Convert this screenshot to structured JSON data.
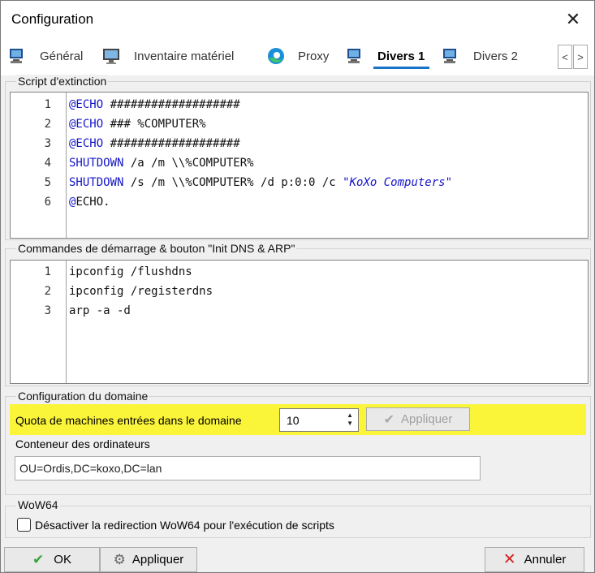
{
  "window": {
    "title": "Configuration"
  },
  "tabs": [
    {
      "label": "Général",
      "icon": "computer-icon"
    },
    {
      "label": "Inventaire matériel",
      "icon": "monitor-icon"
    },
    {
      "label": "Proxy",
      "icon": "edge-icon"
    },
    {
      "label": "Divers 1",
      "icon": "computer-icon",
      "active": true
    },
    {
      "label": "Divers 2",
      "icon": "computer-icon"
    }
  ],
  "tab_scroll": {
    "prev": "<",
    "next": ">"
  },
  "shutdown_script": {
    "label": "Script d'extinction",
    "lines": [
      {
        "n": "1",
        "parts": [
          {
            "t": "@ECHO",
            "k": "kw"
          },
          {
            "t": " ###################",
            "k": ""
          }
        ]
      },
      {
        "n": "2",
        "parts": [
          {
            "t": "@ECHO",
            "k": "kw"
          },
          {
            "t": " ### %COMPUTER%",
            "k": ""
          }
        ]
      },
      {
        "n": "3",
        "parts": [
          {
            "t": "@ECHO",
            "k": "kw"
          },
          {
            "t": " ###################",
            "k": ""
          }
        ]
      },
      {
        "n": "4",
        "parts": [
          {
            "t": "SHUTDOWN",
            "k": "kw"
          },
          {
            "t": " /a /m \\\\%COMPUTER%",
            "k": ""
          }
        ]
      },
      {
        "n": "5",
        "parts": [
          {
            "t": "SHUTDOWN",
            "k": "kw"
          },
          {
            "t": " /s /m \\\\%COMPUTER% /d p:0:0 /c ",
            "k": ""
          },
          {
            "t": "\"KoXo Computers\"",
            "k": "str"
          }
        ]
      },
      {
        "n": "6",
        "parts": [
          {
            "t": "@",
            "k": "kw"
          },
          {
            "t": "ECHO.",
            "k": ""
          }
        ]
      }
    ]
  },
  "startup_commands": {
    "label": "Commandes de démarrage & bouton \"Init DNS & ARP\"",
    "lines": [
      {
        "n": "1",
        "parts": [
          {
            "t": "ipconfig /flushdns",
            "k": ""
          }
        ]
      },
      {
        "n": "2",
        "parts": [
          {
            "t": "ipconfig /registerdns",
            "k": ""
          }
        ]
      },
      {
        "n": "3",
        "parts": [
          {
            "t": "arp -a -d",
            "k": ""
          }
        ]
      }
    ]
  },
  "domain": {
    "label": "Configuration du domaine",
    "quota_label": "Quota de machines entrées dans le domaine",
    "quota_value": "10",
    "apply_label": "Appliquer",
    "container_label": "Conteneur des ordinateurs",
    "container_value": "OU=Ordis,DC=koxo,DC=lan"
  },
  "wow64": {
    "label": "WoW64",
    "checkbox_label": "Désactiver la redirection WoW64 pour l'exécution de scripts",
    "checked": false
  },
  "footer": {
    "ok_label": "OK",
    "apply_label": "Appliquer",
    "cancel_label": "Annuler"
  },
  "colors": {
    "highlight": "#fbf53a",
    "keyword": "#1414c8",
    "tab_underline": "#1a73c8",
    "ok_check": "#3aa33a",
    "cancel_x": "#d42020"
  }
}
